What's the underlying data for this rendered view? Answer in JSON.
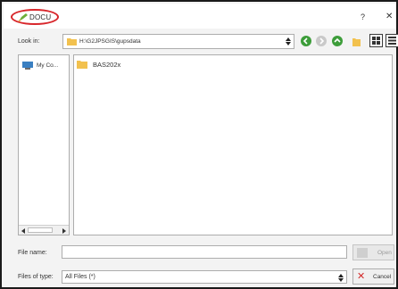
{
  "window": {
    "title": "DOCU",
    "help_glyph": "?",
    "close_glyph": "✕",
    "highlight_color": "#d8262b"
  },
  "toolbar": {
    "look_in_label": "Look in:",
    "look_in_path": "H:\\G2JPSGIS\\gupsdata",
    "icons": [
      "back-icon",
      "forward-icon",
      "parent-directory-icon",
      "new-folder-icon",
      "list-view-icon",
      "detail-view-icon"
    ]
  },
  "sidebar": {
    "items": [
      {
        "label": "My Co...",
        "icon": "computer-icon"
      }
    ]
  },
  "files": [
    {
      "name": "BAS202x",
      "icon": "folder-icon"
    }
  ],
  "footer": {
    "file_name_label": "File name:",
    "file_name_value": "",
    "open_label": "Open",
    "files_of_type_label": "Files of type:",
    "files_of_type_value": "All Files (*)",
    "cancel_label": "Cancel"
  },
  "colors": {
    "accent_green": "#3d9d3a",
    "folder_yellow": "#f2c14e",
    "cancel_red": "#d32a2a"
  }
}
